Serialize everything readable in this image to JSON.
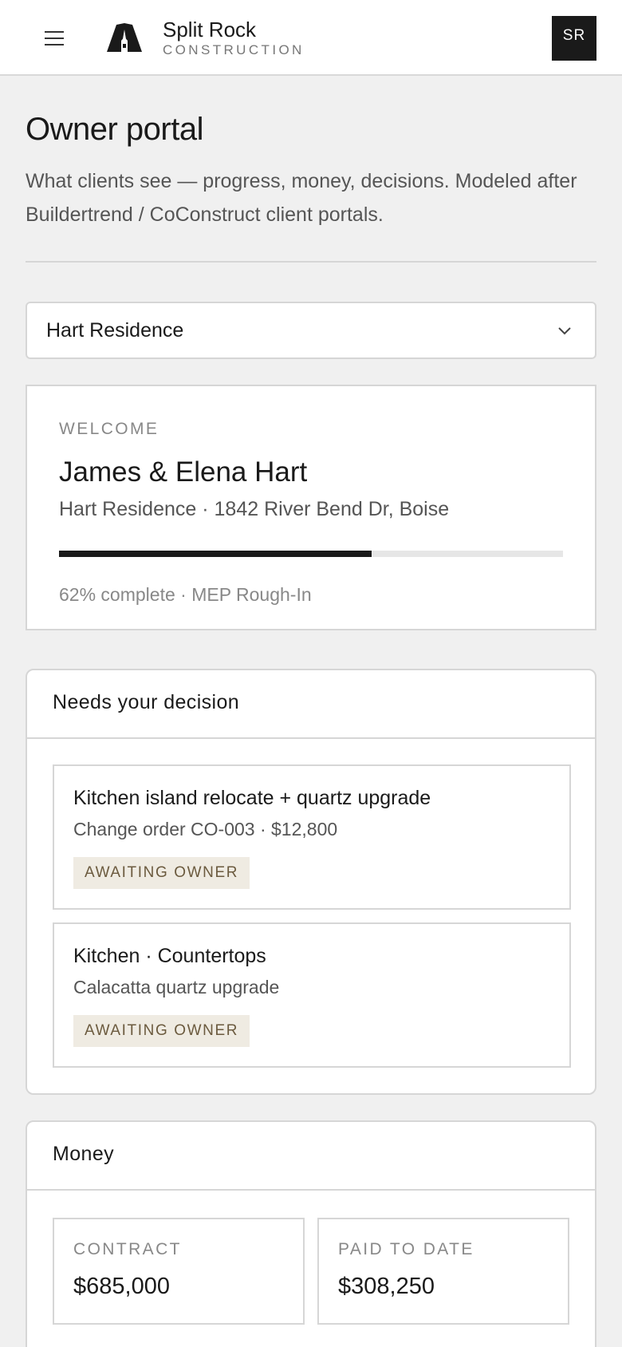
{
  "header": {
    "brand_name": "Split Rock",
    "brand_sub": "CONSTRUCTION",
    "avatar_initials": "SR",
    "menu_icon": "hamburger-menu-icon",
    "logo_icon": "split-rock-logo-icon"
  },
  "page": {
    "title": "Owner portal",
    "description": "What clients see — progress, money, decisions. Modeled after Buildertrend / CoConstruct client portals."
  },
  "project_select": {
    "selected": "Hart Residence",
    "icon": "chevron-down-icon"
  },
  "welcome": {
    "label": "WELCOME",
    "name": "James & Elena Hart",
    "address": "Hart Residence · 1842 River Bend Dr, Boise",
    "progress_percent": 62,
    "progress_text": "62% complete · MEP Rough-In"
  },
  "decisions": {
    "title": "Needs your decision",
    "items": [
      {
        "title": "Kitchen island relocate + quartz upgrade",
        "subtitle": "Change order CO-003 · $12,800",
        "status": "AWAITING OWNER"
      },
      {
        "title": "Kitchen · Countertops",
        "subtitle": "Calacatta quartz upgrade",
        "status": "AWAITING OWNER"
      }
    ]
  },
  "money": {
    "title": "Money",
    "contract_label": "CONTRACT",
    "contract_value": "$685,000",
    "paid_label": "PAID TO DATE",
    "paid_value": "$308,250"
  },
  "colors": {
    "accent": "#1a1a1a",
    "background": "#f0f0f0",
    "badge_bg": "#efebe2",
    "badge_text": "#6b5a3e"
  }
}
